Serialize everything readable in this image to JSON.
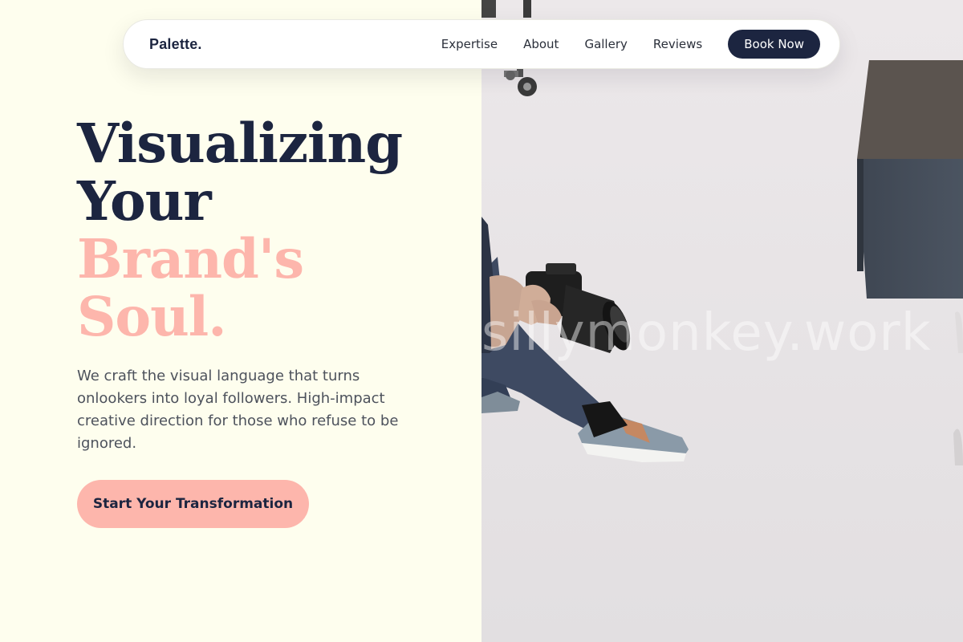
{
  "nav": {
    "brand": "Palette.",
    "links": [
      "Expertise",
      "About",
      "Gallery",
      "Reviews"
    ],
    "cta": "Book Now"
  },
  "hero": {
    "title_lines": [
      "Visualizing",
      "Your",
      "Brand's",
      "Soul."
    ],
    "description": "We craft the visual language that turns onlookers into loyal followers. High-impact creative direction for those who refuse to be ignored.",
    "cta": "Start Your Transformation"
  },
  "photo": {
    "watermark": "sillymonkey.work"
  },
  "colors": {
    "navy": "#1c2540",
    "accent_pink": "#fdb6ac",
    "cream_background": "#fefeee"
  }
}
